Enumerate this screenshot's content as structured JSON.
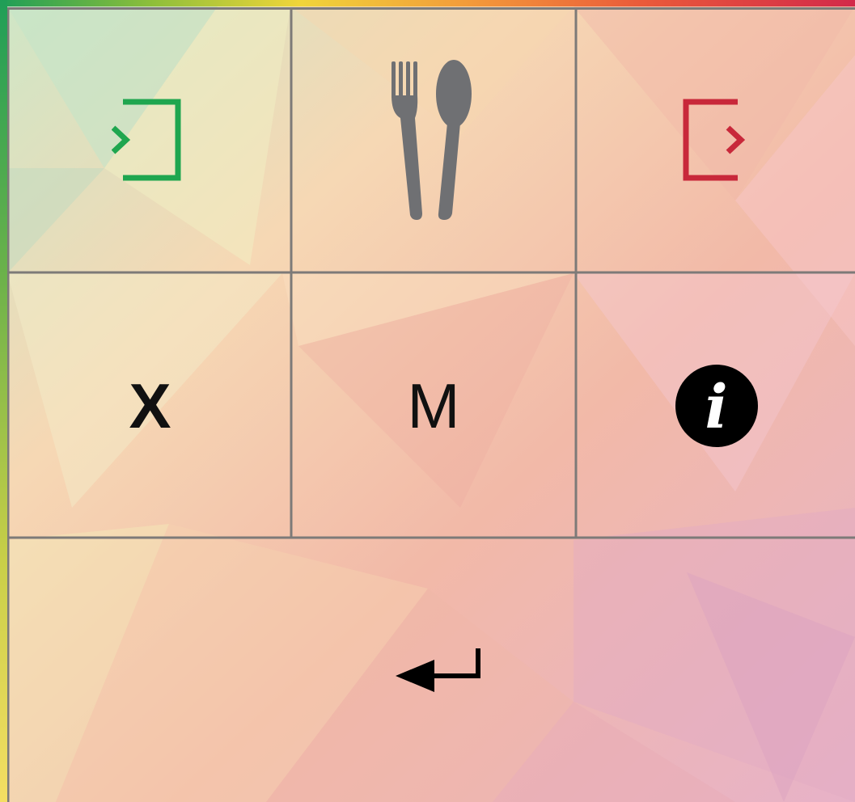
{
  "keypad": {
    "keys": [
      {
        "name": "check-in-key",
        "icon": "check-in-icon",
        "color": "#1fa64f"
      },
      {
        "name": "dining-key",
        "icon": "fork-spoon-icon",
        "color": "#6f7073"
      },
      {
        "name": "check-out-key",
        "icon": "check-out-icon",
        "color": "#c8283a"
      },
      {
        "name": "cancel-key",
        "label": "X"
      },
      {
        "name": "menu-key",
        "label": "M"
      },
      {
        "name": "info-key",
        "icon": "info-icon",
        "glyph": "i"
      },
      {
        "name": "enter-key",
        "icon": "enter-arrow-icon"
      }
    ]
  },
  "colors": {
    "grid_line": "#7d7a78",
    "check_in": "#1fa64f",
    "check_out": "#c8283a",
    "icon_gray": "#6f7073",
    "text": "#111111"
  }
}
